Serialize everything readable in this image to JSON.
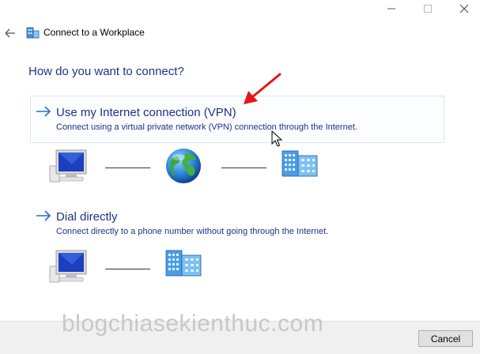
{
  "window": {
    "title": "Connect to a Workplace",
    "caption_icons": [
      "minimize-icon",
      "maximize-icon",
      "close-icon"
    ]
  },
  "main": {
    "heading": "How do you want to connect?",
    "options": [
      {
        "title": "Use my Internet connection (VPN)",
        "description": "Connect using a virtual private network (VPN) connection through the Internet.",
        "diagram": [
          "computer-icon",
          "globe-icon",
          "workplace-network-icon"
        ]
      },
      {
        "title": "Dial directly",
        "description": "Connect directly to a phone number without going through the Internet.",
        "diagram": [
          "computer-icon",
          "workplace-network-icon"
        ]
      }
    ]
  },
  "footer": {
    "cancel_label": "Cancel"
  },
  "watermark": "blogchiasekienthuc.com",
  "colors": {
    "link_blue": "#1e3287",
    "arrow_blue": "#2a6fc9",
    "annotation_red": "#e8151b",
    "footer_bg": "#f0f0f0"
  }
}
